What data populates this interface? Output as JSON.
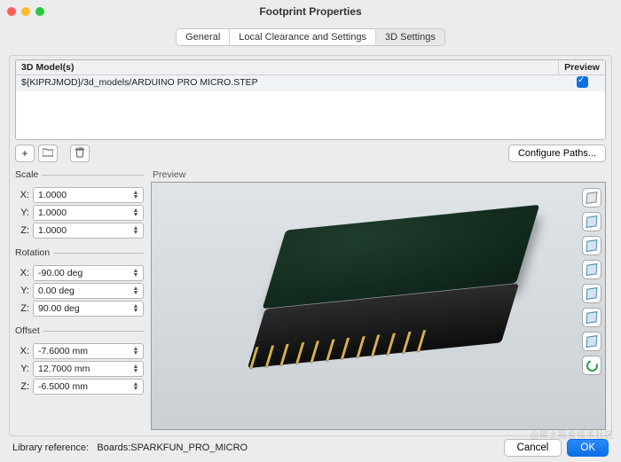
{
  "window": {
    "title": "Footprint Properties"
  },
  "tabs": {
    "general": "General",
    "local": "Local Clearance and Settings",
    "settings3d": "3D Settings"
  },
  "table": {
    "header_models": "3D Model(s)",
    "header_preview": "Preview",
    "rows": [
      {
        "path": "${KIPRJMOD}/3d_models/ARDUINO PRO MICRO.STEP",
        "preview": true
      }
    ]
  },
  "toolbar": {
    "add": "+",
    "folder": "▢",
    "trash": "🗑",
    "configure": "Configure Paths..."
  },
  "groups": {
    "scale": {
      "legend": "Scale",
      "x": "1.0000",
      "y": "1.0000",
      "z": "1.0000"
    },
    "rotation": {
      "legend": "Rotation",
      "x": "-90.00 deg",
      "y": "0.00 deg",
      "z": "90.00 deg"
    },
    "offset": {
      "legend": "Offset",
      "x": "-7.6000 mm",
      "y": "12.7000 mm",
      "z": "-6.5000 mm"
    }
  },
  "labels": {
    "X": "X:",
    "Y": "Y:",
    "Z": "Z:"
  },
  "preview": {
    "label": "Preview"
  },
  "footer": {
    "lib_label": "Library reference:",
    "lib_value": "Boards:SPARKFUN_PRO_MICRO",
    "cancel": "Cancel",
    "ok": "OK"
  },
  "watermark": "@稀土掘金技术社区"
}
